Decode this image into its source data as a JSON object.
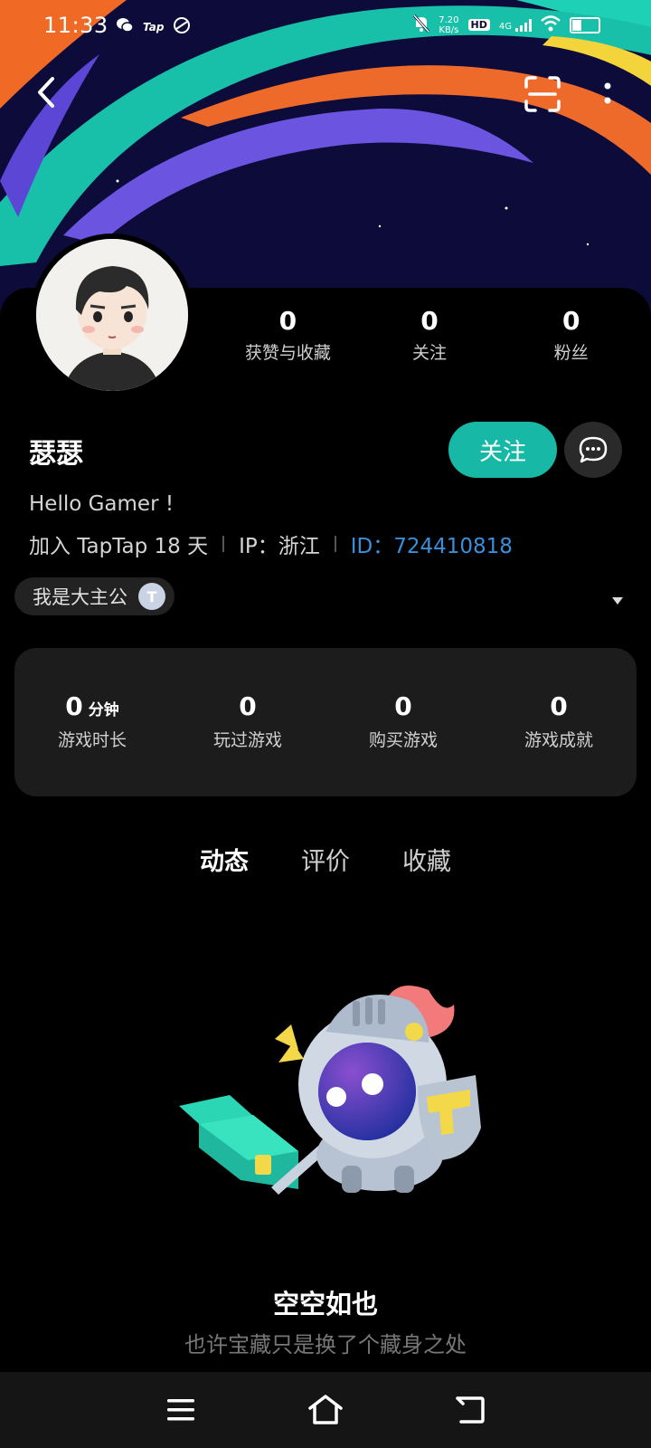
{
  "status_bar": {
    "time": "11:33",
    "speed": "7.20",
    "speed_unit": "KB/s",
    "hd": "HD",
    "net": "4G",
    "battery_level": 0.35
  },
  "profile": {
    "name": "瑟瑟",
    "bio": "Hello Gamer !",
    "joined": "加入 TapTap 18 天",
    "ip": "IP：浙江",
    "id": "ID：724410818",
    "badge": "我是大主公",
    "badge_letter": "T"
  },
  "stats": [
    {
      "num": "0",
      "label": "获赞与收藏"
    },
    {
      "num": "0",
      "label": "关注"
    },
    {
      "num": "0",
      "label": "粉丝"
    }
  ],
  "actions": {
    "follow": "关注"
  },
  "game_stats": [
    {
      "num": "0",
      "unit": "分钟",
      "label": "游戏时长"
    },
    {
      "num": "0",
      "unit": "",
      "label": "玩过游戏"
    },
    {
      "num": "0",
      "unit": "",
      "label": "购买游戏"
    },
    {
      "num": "0",
      "unit": "",
      "label": "游戏成就"
    }
  ],
  "tabs": [
    {
      "label": "动态",
      "active": true
    },
    {
      "label": "评价",
      "active": false
    },
    {
      "label": "收藏",
      "active": false
    }
  ],
  "empty": {
    "title": "空空如也",
    "subtitle": "也许宝藏只是换了个藏身之处"
  },
  "colors": {
    "accent": "#17b8a6",
    "id_link": "#3a8fd8"
  }
}
